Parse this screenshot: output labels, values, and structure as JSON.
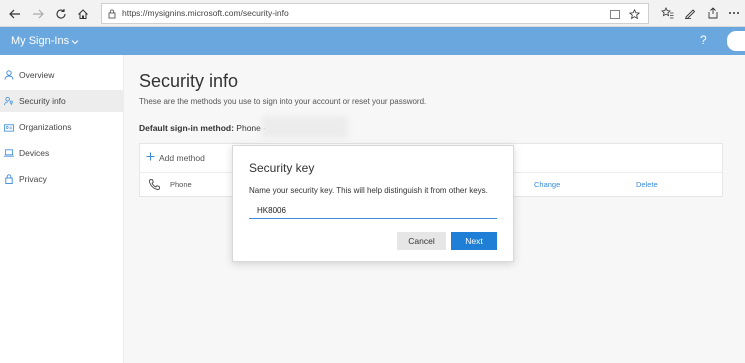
{
  "browser": {
    "url": "https://mysignins.microsoft.com/security-info",
    "icons": [
      "back-icon",
      "forward-icon",
      "refresh-icon",
      "home-icon",
      "lock-icon",
      "reading-view-icon",
      "favorite-star-icon",
      "favorites-icon",
      "pen-icon",
      "share-icon",
      "more-icon"
    ]
  },
  "app": {
    "title": "My Sign-Ins",
    "help": "?",
    "accent": "#6aa7df"
  },
  "sidebar": {
    "items": [
      {
        "label": "Overview",
        "icon": "person-icon"
      },
      {
        "label": "Security info",
        "icon": "security-info-icon",
        "active": true
      },
      {
        "label": "Organizations",
        "icon": "organizations-icon"
      },
      {
        "label": "Devices",
        "icon": "laptop-icon"
      },
      {
        "label": "Privacy",
        "icon": "lock-icon"
      }
    ]
  },
  "main": {
    "title": "Security info",
    "description": "These are the methods you use to sign into your account or reset your password.",
    "default_label": "Default sign-in method:",
    "default_value": "Phone -",
    "add_method": "Add method",
    "methods": [
      {
        "name": "Phone",
        "change": "Change",
        "delete": "Delete"
      }
    ]
  },
  "modal": {
    "title": "Security key",
    "text": "Name your security key. This will help distinguish it from other keys.",
    "input_value": "HK8006",
    "cancel": "Cancel",
    "next": "Next",
    "primary_color": "#1f7fd6"
  }
}
